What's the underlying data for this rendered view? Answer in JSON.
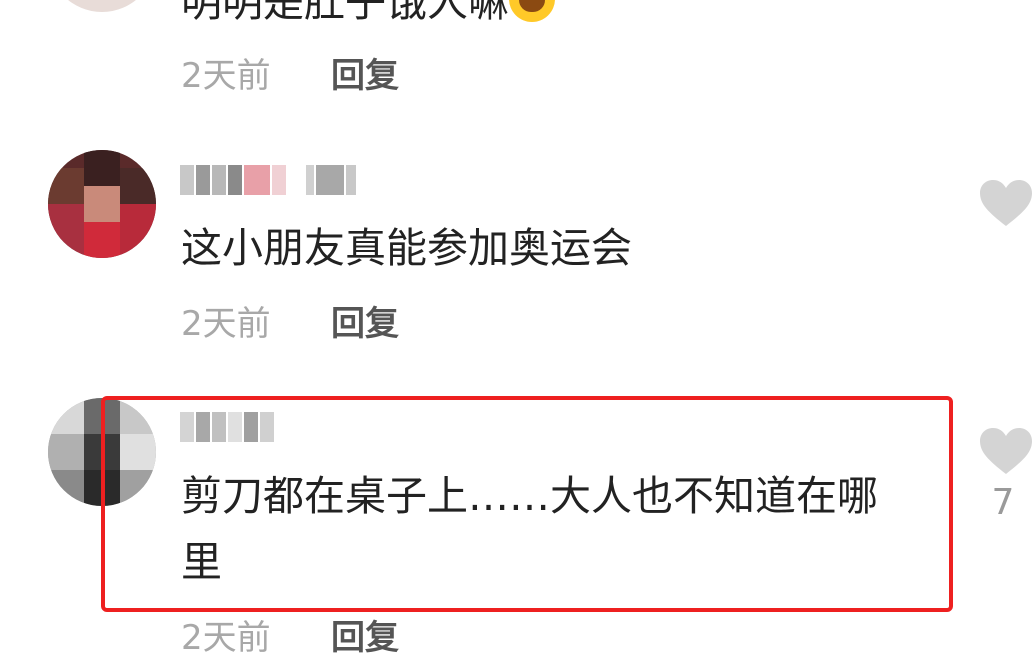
{
  "comments": [
    {
      "text": "明明是肚子饿人嘛",
      "time": "2天前",
      "reply": "回复"
    },
    {
      "text": "这小朋友真能参加奥运会",
      "time": "2天前",
      "reply": "回复"
    },
    {
      "text_line1": "剪刀都在桌子上……大人也不知道在哪",
      "text_line2": "里",
      "time": "2天前",
      "reply": "回复",
      "like_count": "7"
    }
  ],
  "colors": {
    "highlight_border": "#ee2020",
    "like_icon": "#d4d4d4",
    "time_text": "#a8a8a8"
  },
  "icons": {
    "like": "heart-icon",
    "emoji": "laughing-tears-emoji-icon"
  }
}
